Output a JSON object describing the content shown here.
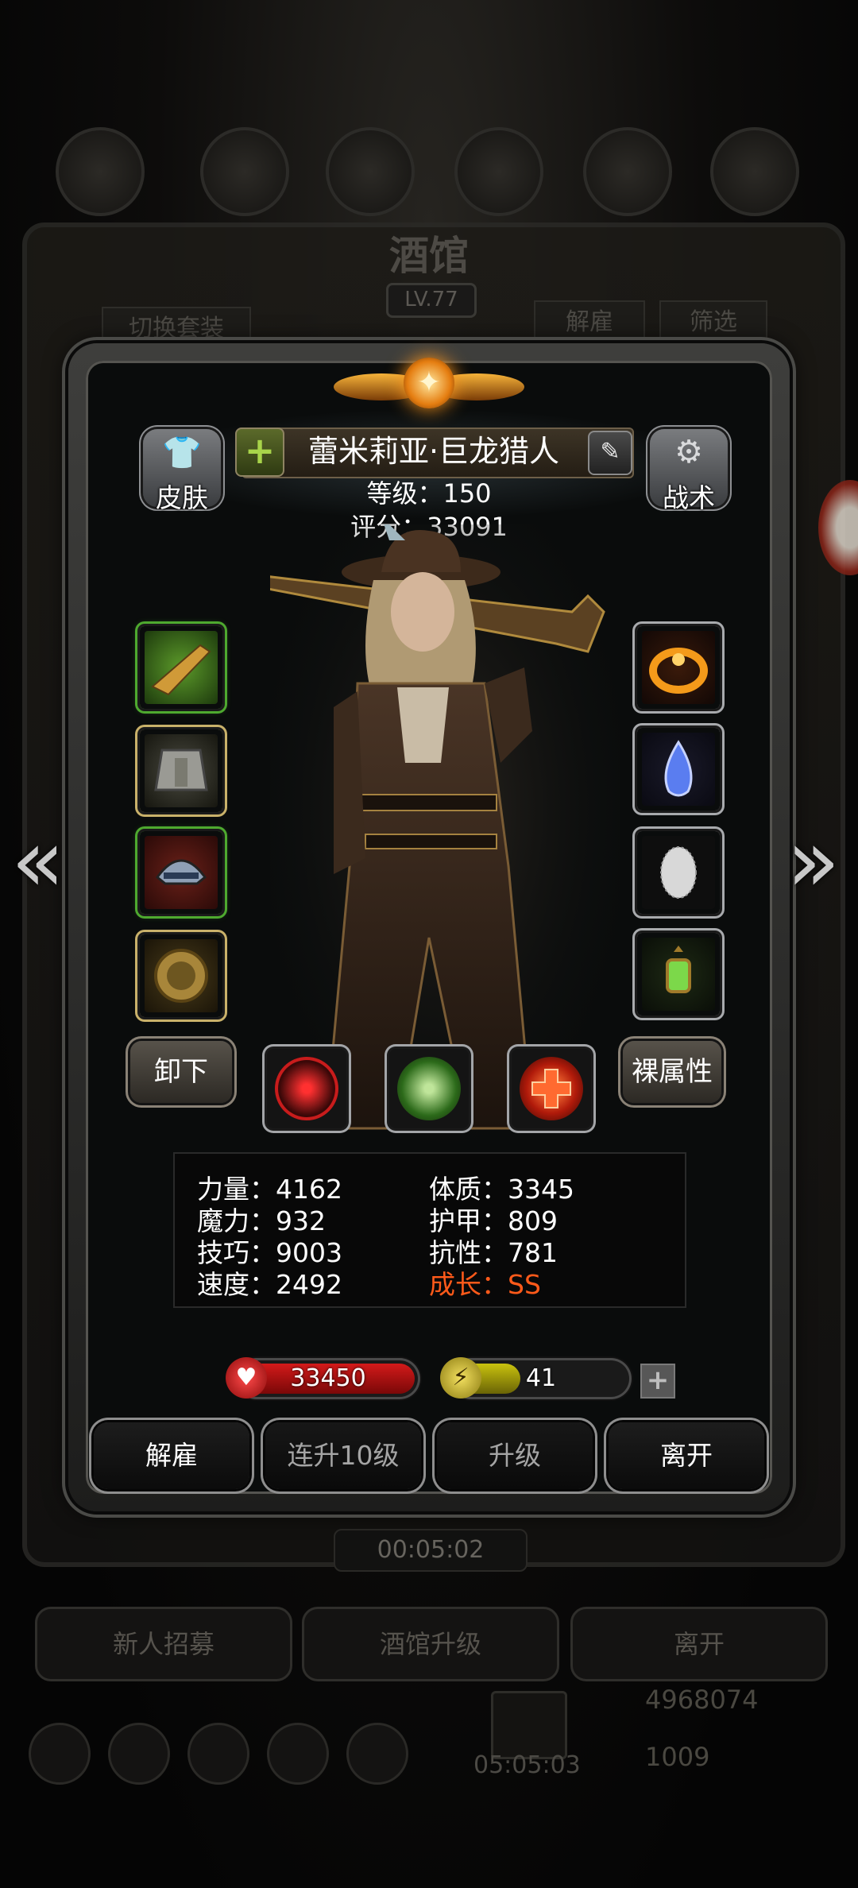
{
  "background": {
    "title": "酒馆",
    "level": "LV.77",
    "tab_switch_outfit": "切换套装",
    "tab_dismiss": "解雇",
    "tab_filter": "筛选",
    "timer": "00:05:02",
    "buttons": [
      "新人招募",
      "酒馆升级",
      "离开"
    ],
    "gold": "4968074",
    "gems": "1009",
    "chest_timer": "05:05:03"
  },
  "hero": {
    "name": "蕾米莉亚·巨龙猎人",
    "level_text": "等级：150",
    "score_text": "评分：33091"
  },
  "side_buttons": {
    "skin": "皮肤",
    "tactics": "战术"
  },
  "equipment_left": [
    {
      "name": "rifle",
      "icon": "rifle-icon"
    },
    {
      "name": "armor",
      "icon": "armor-icon"
    },
    {
      "name": "helmet",
      "icon": "helmet-icon"
    },
    {
      "name": "amulet",
      "icon": "amulet-icon"
    }
  ],
  "equipment_right": [
    {
      "name": "fire-ring",
      "icon": "fire-ring-icon"
    },
    {
      "name": "blue-crystal",
      "icon": "crystal-icon"
    },
    {
      "name": "scale-mail",
      "icon": "scale-icon"
    },
    {
      "name": "lantern",
      "icon": "lantern-icon"
    }
  ],
  "actions": {
    "unequip": "卸下",
    "base_attributes": "裸属性"
  },
  "stats": {
    "strength": "力量：4162",
    "magic": "魔力：932",
    "skill": "技巧：9003",
    "speed": "速度：2492",
    "constitution": "体质：3345",
    "armor": "护甲：809",
    "resistance": "抗性：781",
    "growth": "成长：SS"
  },
  "hp": "33450",
  "energy": "41",
  "energy_fraction": 0.38,
  "bottom_buttons": {
    "dismiss": "解雇",
    "level_up_10": "连升10级",
    "level_up": "升级",
    "leave": "离开"
  },
  "colors": {
    "growth": "#ff5a1a",
    "hp_bar": "#d31a1a",
    "energy_bar": "#c9c20e"
  }
}
